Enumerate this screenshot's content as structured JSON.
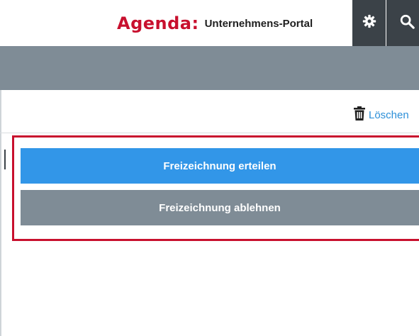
{
  "header": {
    "brand_logo": "Agenda:",
    "brand_subtitle": "Unternehmens-Portal",
    "settings_icon": "gear-icon",
    "search_icon": "search-icon"
  },
  "toolbar": {
    "delete_label": "Löschen",
    "delete_icon": "trash-icon"
  },
  "actions": {
    "approve_label": "Freizeichnung erteilen",
    "reject_label": "Freizeichnung ablehnen"
  },
  "colors": {
    "brand_red": "#c8102e",
    "header_dark": "#3b4248",
    "band_gray": "#7f8c96",
    "primary_blue": "#3296e8",
    "link_blue": "#2c8fd8"
  }
}
